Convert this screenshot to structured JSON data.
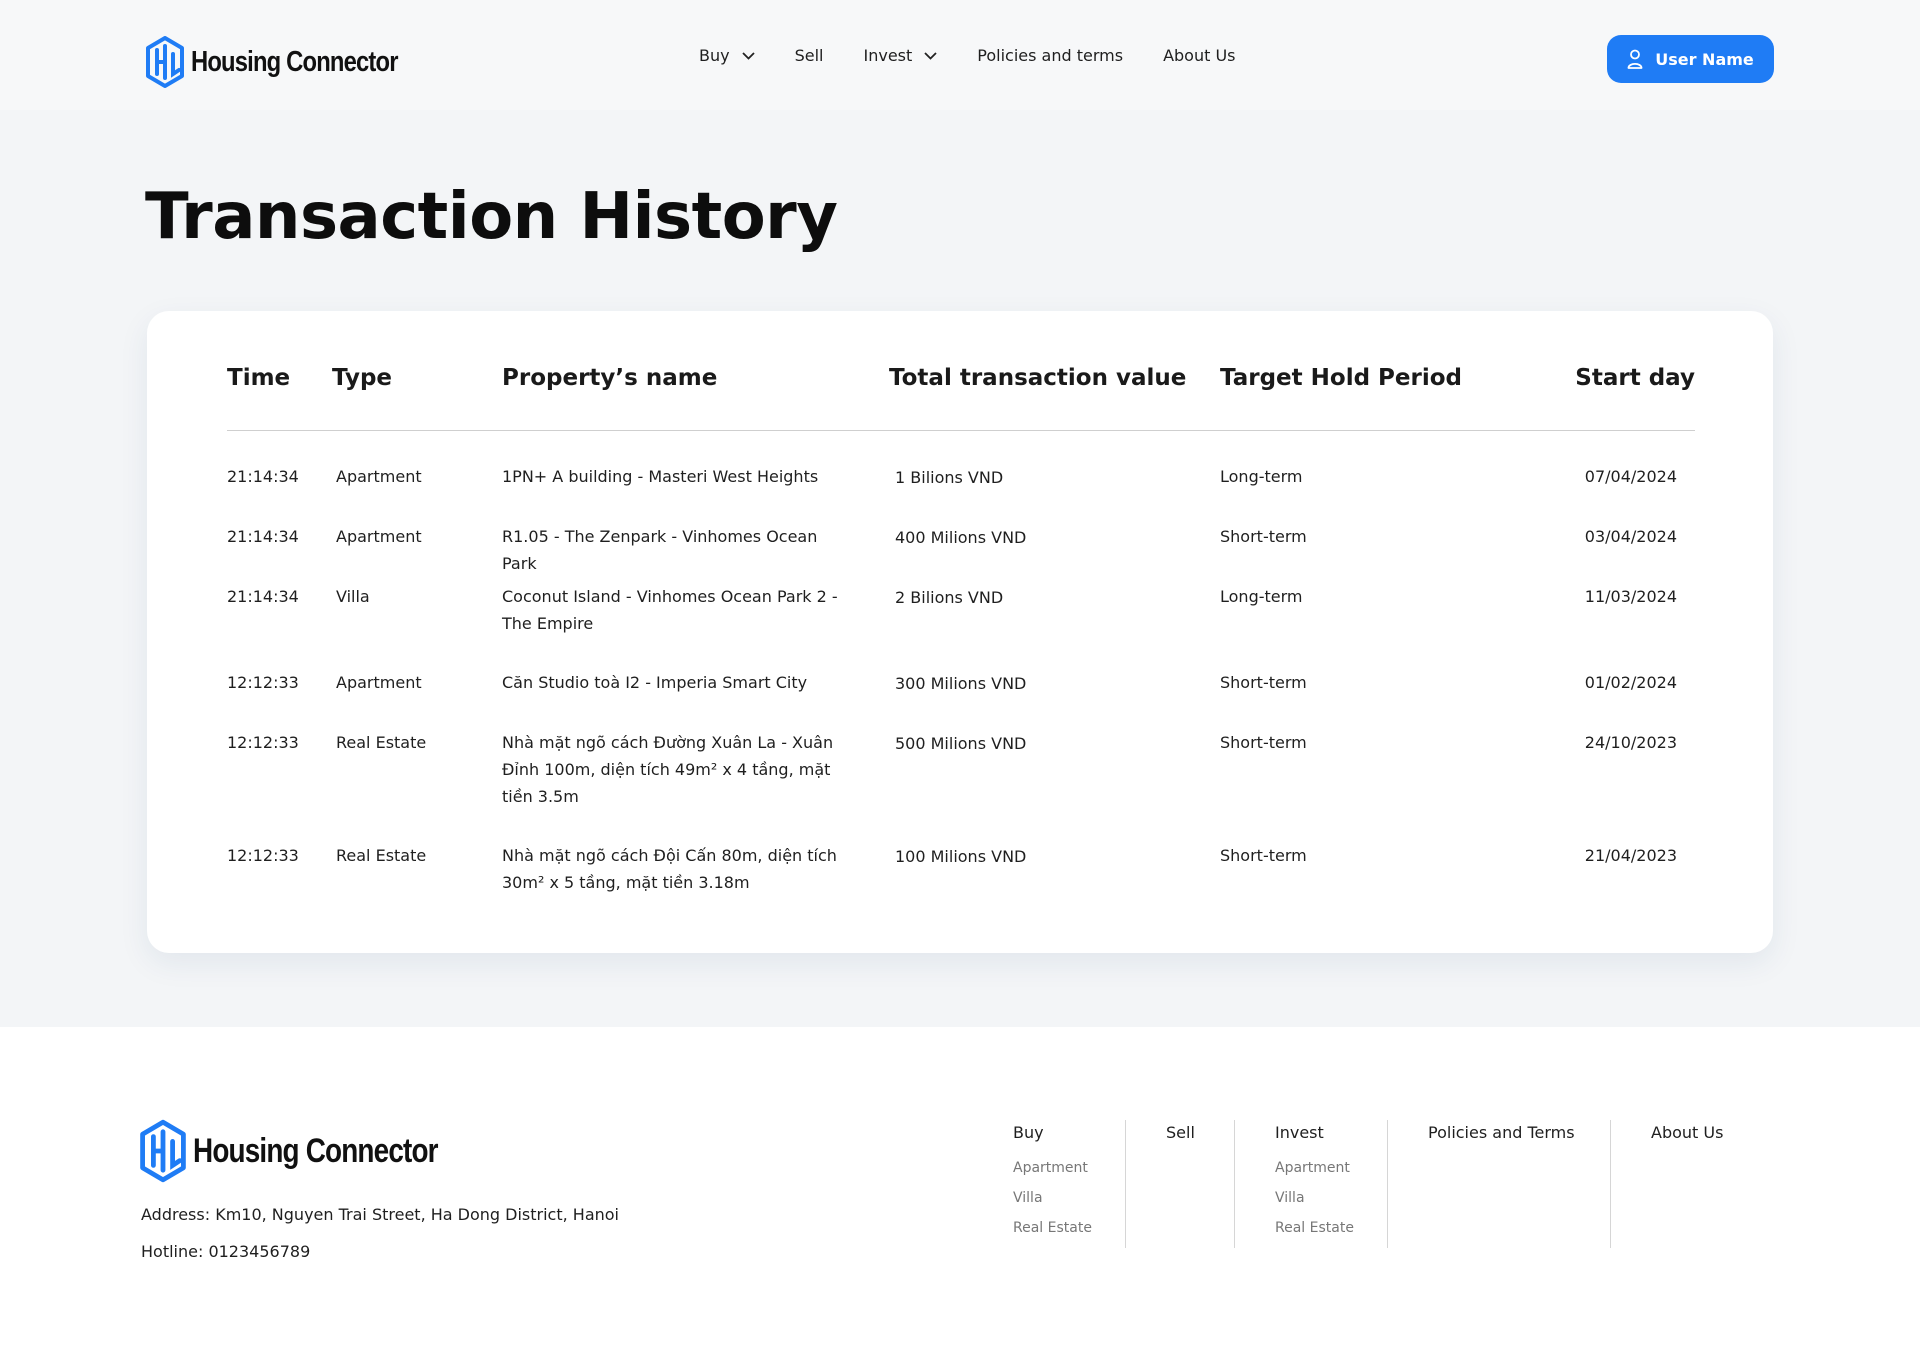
{
  "brand": {
    "name": "Housing Connector"
  },
  "nav": {
    "items": [
      {
        "label": "Buy",
        "has_dropdown": true
      },
      {
        "label": "Sell",
        "has_dropdown": false
      },
      {
        "label": "Invest",
        "has_dropdown": true
      },
      {
        "label": "Policies and terms",
        "has_dropdown": false
      },
      {
        "label": "About Us",
        "has_dropdown": false
      }
    ],
    "user_button": {
      "label": "User Name",
      "icon": "user-icon"
    }
  },
  "page": {
    "title": "Transaction History"
  },
  "table": {
    "columns": [
      "Time",
      "Type",
      "Property’s name",
      "Total transaction value",
      "Target Hold Period",
      "Start day"
    ],
    "rows": [
      {
        "time": "21:14:34",
        "type": "Apartment",
        "name": "1PN+ A building - Masteri West Heights",
        "value": "1 Bilions VND",
        "period": "Long-term",
        "start": "07/04/2024"
      },
      {
        "time": "21:14:34",
        "type": "Apartment",
        "name": "R1.05 - The Zenpark - Vinhomes Ocean Park",
        "value": "400 Milions VND",
        "period": "Short-term",
        "start": "03/04/2024"
      },
      {
        "time": "21:14:34",
        "type": "Villa",
        "name": "Coconut Island - Vinhomes Ocean Park 2 - The Empire",
        "value": "2 Bilions VND",
        "period": "Long-term",
        "start": "11/03/2024"
      },
      {
        "time": "12:12:33",
        "type": "Apartment",
        "name": "Căn Studio toà I2 - Imperia Smart City",
        "value": "300 Milions VND",
        "period": "Short-term",
        "start": "01/02/2024"
      },
      {
        "time": "12:12:33",
        "type": "Real Estate",
        "name": "Nhà mặt ngõ cách Đường Xuân La - Xuân Đỉnh 100m, diện tích 49m² x 4 tầng, mặt tiền 3.5m",
        "value": "500 Milions VND",
        "period": "Short-term",
        "start": "24/10/2023"
      },
      {
        "time": "12:12:33",
        "type": "Real Estate",
        "name": "Nhà mặt ngõ cách Đội Cấn 80m, diện tích 30m² x 5 tầng, mặt tiền 3.18m",
        "value": "100 Milions VND",
        "period": "Short-term",
        "start": "21/04/2023"
      }
    ]
  },
  "footer": {
    "address": "Address: Km10, Nguyen Trai Street, Ha Dong District, Hanoi",
    "hotline": "Hotline: 0123456789",
    "columns": [
      {
        "title": "Buy",
        "items": [
          "Apartment",
          "Villa",
          "Real Estate"
        ]
      },
      {
        "title": "Sell",
        "items": []
      },
      {
        "title": "Invest",
        "items": [
          "Apartment",
          "Villa",
          "Real Estate"
        ]
      },
      {
        "title": "Policies and Terms",
        "items": []
      },
      {
        "title": "About Us",
        "items": []
      }
    ]
  },
  "colors": {
    "accent": "#1f7cf5",
    "page_bg": "#f3f5f7",
    "card_bg": "#ffffff"
  }
}
